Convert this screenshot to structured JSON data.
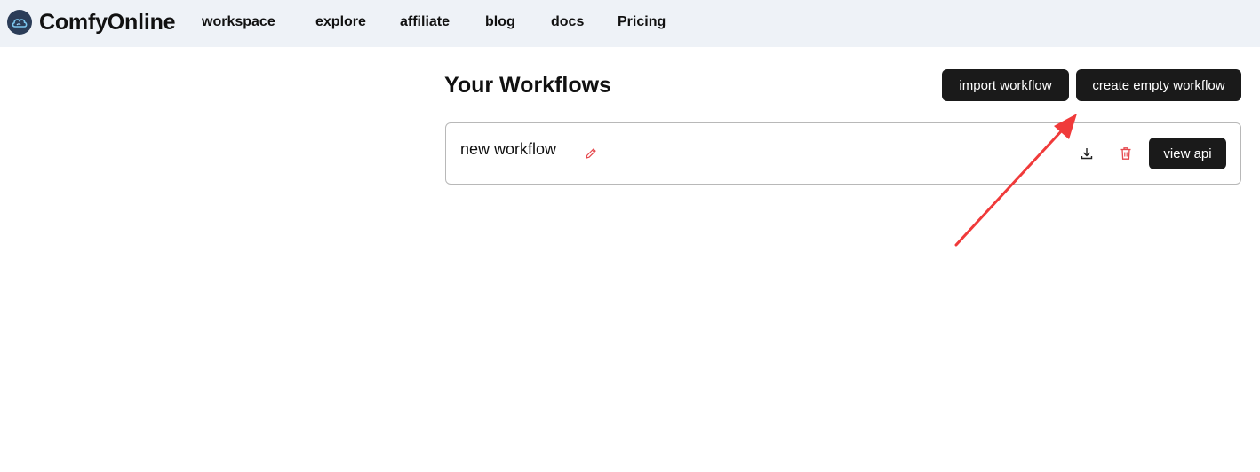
{
  "app": {
    "brand": "ComfyOnline",
    "logo_icon": "cloud-logo-icon"
  },
  "nav": {
    "items": [
      "workspace",
      "explore",
      "affiliate",
      "blog",
      "docs",
      "Pricing"
    ]
  },
  "main": {
    "title": "Your Workflows",
    "import_label": "import workflow",
    "create_label": "create empty workflow"
  },
  "workflows": [
    {
      "name": "new workflow",
      "edit_icon": "pencil-icon",
      "download_icon": "download-icon",
      "delete_icon": "trash-icon",
      "view_api_label": "view api"
    }
  ],
  "annotation": {
    "type": "red-arrow",
    "points_to": "create empty workflow"
  },
  "colors": {
    "topbar_bg": "#eef2f7",
    "button_bg": "#1a1a1a",
    "danger": "#e5484d",
    "annotation": "#f03a3a"
  }
}
